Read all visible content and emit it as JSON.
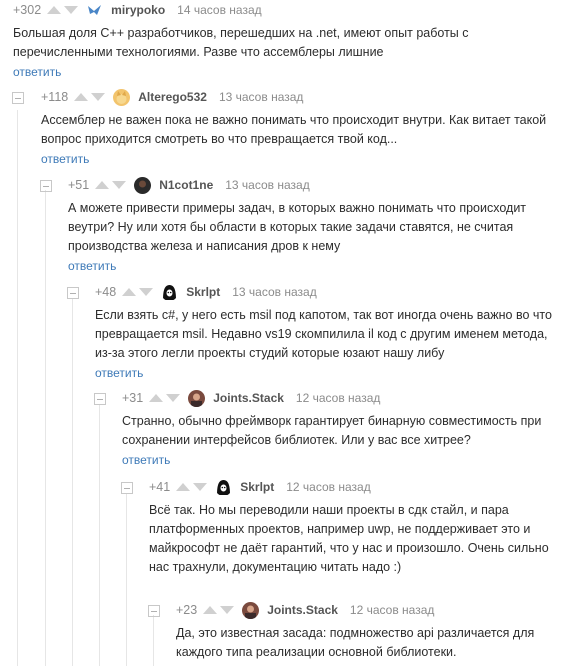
{
  "reply_label": "ответить",
  "colors": {
    "link": "#3d79b7",
    "meta": "#8b8b8b",
    "text": "#2d2d2d"
  },
  "comments": [
    {
      "score": "+302",
      "user": "mirypoko",
      "time": "14 часов назад",
      "text": "Большая доля C++ разработчиков, перешедших на .net, имеют опыт работы с перечисленными технологиями. Разве что ассемблеры лишние",
      "avatar": "bird-icon"
    },
    {
      "score": "+118",
      "user": "Alterego532",
      "time": "13 часов назад",
      "text": "Ассемблер не важен пока не важно понимать что происходит внутри. Как витает такой вопрос приходится смотреть во что превращается твой код...",
      "avatar": "cat-avatar-icon"
    },
    {
      "score": "+51",
      "user": "N1cot1ne",
      "time": "13 часов назад",
      "text": "А можете привести примеры задач, в которых важно понимать что происходит веутри? Ну или хотя бы области в которых такие задачи ставятся, не считая производства железа и написания дров к нему",
      "avatar": "dark-avatar-icon"
    },
    {
      "score": "+48",
      "user": "Skrlpt",
      "time": "13 часов назад",
      "text": "Если взять c#, у него есть msil под капотом, так вот иногда очень важно во что превращается msil. Недавно vs19 скомпилила il код с другим именем метода, из-за этого легли проекты студий которые юзают нашу либу",
      "avatar": "hooded-avatar-icon"
    },
    {
      "score": "+31",
      "user": "Joints.Stack",
      "time": "12 часов назад",
      "text": "Странно, обычно фреймворк гарантирует бинарную совместимость при сохранении интерфейсов библиотек. Или у вас все хитрее?",
      "avatar": "photo-avatar-icon"
    },
    {
      "score": "+41",
      "user": "Skrlpt",
      "time": "12 часов назад",
      "text": "Всё так. Но мы переводили наши проекты в сдк стайл, и пара платформенных проектов, например uwp, не поддерживает это и майкрософт не даёт гарантий, что у нас и произошло. Очень сильно нас трахнули, документацию читать надо :)",
      "avatar": "hooded-avatar-icon"
    },
    {
      "score": "+23",
      "user": "Joints.Stack",
      "time": "12 часов назад",
      "text": "Да, это известная засада: подмножество api различается для каждого типа реализации основной библиотеки.",
      "avatar": "photo-avatar-icon"
    }
  ]
}
